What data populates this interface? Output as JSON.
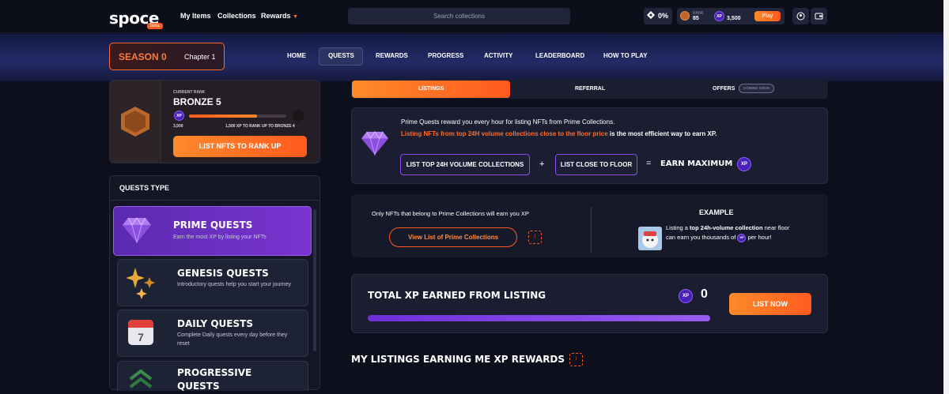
{
  "brand": {
    "logo": "spoce",
    "badge": "beta"
  },
  "top_nav": {
    "my_items": "My Items",
    "collections": "Collections",
    "rewards": "Rewards"
  },
  "search": {
    "placeholder": "Search collections"
  },
  "stats": {
    "percent": "0%",
    "rank_label": "RANK",
    "rank_value": "85",
    "xp_label": "XP",
    "xp_value": "3,500",
    "play": "Play"
  },
  "season": {
    "title": "SEASON 0",
    "chapter": "Chapter 1"
  },
  "main_tabs": [
    "HOME",
    "QUESTS",
    "REWARDS",
    "PROGRESS",
    "ACTIVITY",
    "LEADERBOARD",
    "HOW TO PLAY"
  ],
  "rank": {
    "label": "CURRENT RANK",
    "value": "BRONZE 5",
    "xp_badge": "XP",
    "xp_current": "3,500",
    "xp_to_next": "1,500 XP TO RANK UP TO BRONZE 4",
    "progress": 0.7,
    "cta": "LIST NFTS TO RANK UP"
  },
  "quests_type": {
    "title": "QUESTS TYPE",
    "items": [
      {
        "title": "PRIME QUESTS",
        "desc": "Earn the most XP by listing your NFTs"
      },
      {
        "title": "GENESIS QUESTS",
        "desc": "Introductory quests help you start your journey"
      },
      {
        "title": "DAILY QUESTS",
        "desc": "Complete Daily quests every day before they reset"
      },
      {
        "title": "PROGRESSIVE QUESTS",
        "desc": ""
      }
    ],
    "calendar_day": "7"
  },
  "sub_tabs": {
    "listings": "LISTINGS",
    "referral": "REFERRAL",
    "offers": "OFFERS",
    "coming_soon": "COMING SOON"
  },
  "prime_info": {
    "line1": "Prime Quests reward you every hour for listing NFTs from Prime Collections.",
    "line2_highlight": "Listing NFTs from top 24H volume collections close to the floor price",
    "line2_rest": " is the most efficient way to earn XP.",
    "pill1": "LIST TOP 24H VOLUME COLLECTIONS",
    "plus": "+",
    "pill2": "LIST CLOSE TO FLOOR",
    "equals": "=",
    "earn": "EARN MAXIMUM",
    "xp": "XP"
  },
  "example": {
    "only_text": "Only NFTs that belong to Prime Collections will earn you XP",
    "view_btn": "View List of Prime Collections",
    "info_mark": "i",
    "title": "EXAMPLE",
    "text_a": "Listing a ",
    "text_bold": "top 24h-volume collection",
    "text_b": " near floor can earn you thousands of ",
    "text_c": " per hour!"
  },
  "total": {
    "title": "TOTAL XP EARNED FROM LISTING",
    "xp": "XP",
    "value": "0",
    "cta": "LIST NOW",
    "progress": 1.0
  },
  "my_listings": {
    "title": "MY LISTINGS EARNING ME XP REWARDS"
  },
  "colors": {
    "accent": "#ff5a1f",
    "purple": "#7a34d0",
    "bg": "#0d0f1c"
  }
}
